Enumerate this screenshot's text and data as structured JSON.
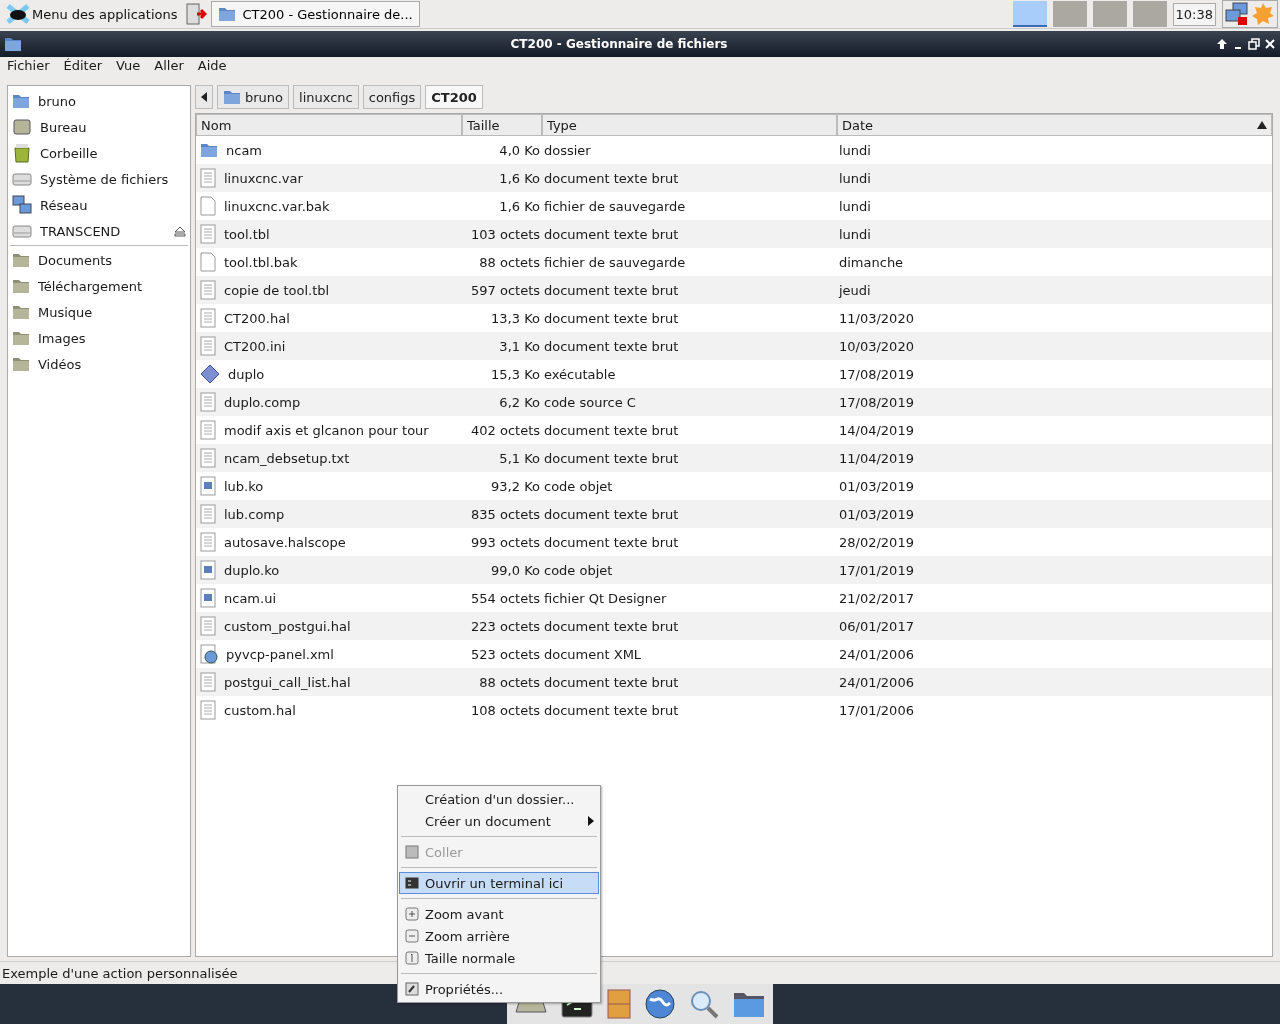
{
  "panel": {
    "app_menu": "Menu des applications",
    "tasks": [
      {
        "label": "CT200 - Gestionnaire de...",
        "selected": true
      }
    ],
    "workspaces": [
      {
        "selected": true
      },
      {
        "selected": false
      },
      {
        "selected": false
      },
      {
        "selected": false
      }
    ],
    "clock": "10:38"
  },
  "window": {
    "title": "CT200 - Gestionnaire de fichiers"
  },
  "menubar": [
    "Fichier",
    "Éditer",
    "Vue",
    "Aller",
    "Aide"
  ],
  "sidebar": {
    "groups": [
      [
        {
          "label": "bruno",
          "kind": "home",
          "eject": false
        },
        {
          "label": "Bureau",
          "kind": "desktop",
          "eject": false
        },
        {
          "label": "Corbeille",
          "kind": "trash",
          "eject": false
        },
        {
          "label": "Système de fichiers",
          "kind": "drive",
          "eject": false
        },
        {
          "label": "Réseau",
          "kind": "network",
          "eject": false
        },
        {
          "label": "TRANSCEND",
          "kind": "drive",
          "eject": true
        }
      ],
      [
        {
          "label": "Documents",
          "kind": "folder",
          "eject": false
        },
        {
          "label": "Téléchargement",
          "kind": "folder",
          "eject": false
        },
        {
          "label": "Musique",
          "kind": "folder",
          "eject": false
        },
        {
          "label": "Images",
          "kind": "folder",
          "eject": false
        },
        {
          "label": "Vidéos",
          "kind": "folder",
          "eject": false
        }
      ]
    ]
  },
  "path_bar": [
    {
      "label": "bruno",
      "selected": false,
      "home": true
    },
    {
      "label": "linuxcnc",
      "selected": false,
      "home": false
    },
    {
      "label": "configs",
      "selected": false,
      "home": false
    },
    {
      "label": "CT200",
      "selected": true,
      "home": false
    }
  ],
  "table": {
    "columns": [
      {
        "label": "Nom",
        "sorted": false
      },
      {
        "label": "Taille",
        "sorted": false
      },
      {
        "label": "Type",
        "sorted": false
      },
      {
        "label": "Date",
        "sorted": true
      }
    ],
    "rows": [
      {
        "kind": "folder",
        "name": "ncam",
        "size": "4,0 Ko",
        "type": "dossier",
        "date": "lundi"
      },
      {
        "kind": "text",
        "name": "linuxcnc.var",
        "size": "1,6 Ko",
        "type": "document texte brut",
        "date": "lundi"
      },
      {
        "kind": "backup",
        "name": "linuxcnc.var.bak",
        "size": "1,6 Ko",
        "type": "fichier de sauvegarde",
        "date": "lundi"
      },
      {
        "kind": "text",
        "name": "tool.tbl",
        "size": "103 octets",
        "type": "document texte brut",
        "date": "lundi"
      },
      {
        "kind": "backup",
        "name": "tool.tbl.bak",
        "size": "88 octets",
        "type": "fichier de sauvegarde",
        "date": "dimanche"
      },
      {
        "kind": "text",
        "name": "copie de tool.tbl",
        "size": "597 octets",
        "type": "document texte brut",
        "date": "jeudi"
      },
      {
        "kind": "text",
        "name": "CT200.hal",
        "size": "13,3 Ko",
        "type": "document texte brut",
        "date": "11/03/2020"
      },
      {
        "kind": "text",
        "name": "CT200.ini",
        "size": "3,1 Ko",
        "type": "document texte brut",
        "date": "10/03/2020"
      },
      {
        "kind": "executable",
        "name": "duplo",
        "size": "15,3 Ko",
        "type": "exécutable",
        "date": "17/08/2019"
      },
      {
        "kind": "text",
        "name": "duplo.comp",
        "size": "6,2 Ko",
        "type": "code source C",
        "date": "17/08/2019"
      },
      {
        "kind": "text",
        "name": "modif axis et glcanon pour tour",
        "size": "402 octets",
        "type": "document texte brut",
        "date": "14/04/2019"
      },
      {
        "kind": "text",
        "name": "ncam_debsetup.txt",
        "size": "5,1 Ko",
        "type": "document texte brut",
        "date": "11/04/2019"
      },
      {
        "kind": "object",
        "name": "lub.ko",
        "size": "93,2 Ko",
        "type": "code objet",
        "date": "01/03/2019"
      },
      {
        "kind": "text",
        "name": "lub.comp",
        "size": "835 octets",
        "type": "document texte brut",
        "date": "01/03/2019"
      },
      {
        "kind": "text",
        "name": "autosave.halscope",
        "size": "993 octets",
        "type": "document texte brut",
        "date": "28/02/2019"
      },
      {
        "kind": "object",
        "name": "duplo.ko",
        "size": "99,0 Ko",
        "type": "code objet",
        "date": "17/01/2019"
      },
      {
        "kind": "object",
        "name": "ncam.ui",
        "size": "554 octets",
        "type": "fichier Qt Designer",
        "date": "21/02/2017"
      },
      {
        "kind": "text",
        "name": "custom_postgui.hal",
        "size": "223 octets",
        "type": "document texte brut",
        "date": "06/01/2017"
      },
      {
        "kind": "xml",
        "name": "pyvcp-panel.xml",
        "size": "523 octets",
        "type": "document XML",
        "date": "24/01/2006"
      },
      {
        "kind": "text",
        "name": "postgui_call_list.hal",
        "size": "88 octets",
        "type": "document texte brut",
        "date": "24/01/2006"
      },
      {
        "kind": "text",
        "name": "custom.hal",
        "size": "108 octets",
        "type": "document texte brut",
        "date": "17/01/2006"
      }
    ]
  },
  "context_menu": {
    "groups": [
      [
        {
          "label": "Création d'un dossier...",
          "kind": "plain",
          "disabled": false,
          "selected": false,
          "submenu": false
        },
        {
          "label": "Créer un document",
          "kind": "plain",
          "disabled": false,
          "selected": false,
          "submenu": true
        }
      ],
      [
        {
          "label": "Coller",
          "kind": "paste",
          "disabled": true,
          "selected": false,
          "submenu": false
        }
      ],
      [
        {
          "label": "Ouvrir un terminal ici",
          "kind": "terminal",
          "disabled": false,
          "selected": true,
          "submenu": false
        }
      ],
      [
        {
          "label": "Zoom avant",
          "kind": "zoom-in",
          "disabled": false,
          "selected": false,
          "submenu": false
        },
        {
          "label": "Zoom arrière",
          "kind": "zoom-out",
          "disabled": false,
          "selected": false,
          "submenu": false
        },
        {
          "label": "Taille normale",
          "kind": "zoom-normal",
          "disabled": false,
          "selected": false,
          "submenu": false
        }
      ],
      [
        {
          "label": "Propriétés...",
          "kind": "properties",
          "disabled": false,
          "selected": false,
          "submenu": false
        }
      ]
    ]
  },
  "status_bar": "Exemple d'une action personnalisée",
  "dock": [
    {
      "kind": "desktop"
    },
    {
      "kind": "terminal"
    },
    {
      "kind": "files"
    },
    {
      "kind": "browser"
    },
    {
      "kind": "search"
    },
    {
      "kind": "folder"
    }
  ]
}
